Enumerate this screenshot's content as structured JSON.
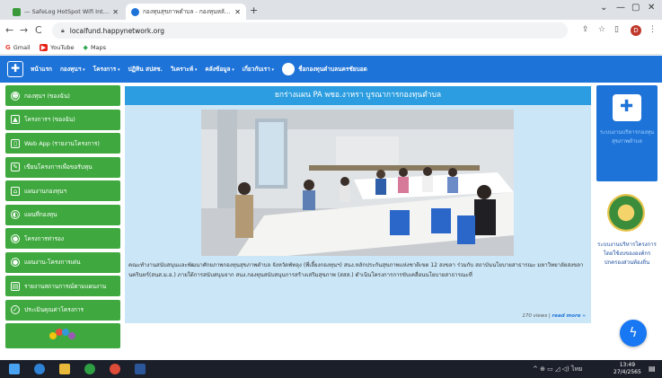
{
  "browser": {
    "tabs": [
      {
        "title": "— SafeLog HotSpot Wifi Internet",
        "active": false
      },
      {
        "title": "กองทุนสุขภาพตำบล - กองทุนหลักประกัน",
        "active": true
      }
    ],
    "new_tab": "+",
    "url": "localfund.happynetwork.org",
    "bookmarks": [
      {
        "label": "Gmail",
        "icon": "G"
      },
      {
        "label": "YouTube",
        "icon": "▶"
      },
      {
        "label": "Maps",
        "icon": "◆"
      }
    ],
    "controls": {
      "minimize": "—",
      "restore": "▢",
      "close": "✕",
      "back": "←",
      "forward": "→",
      "reload": "C",
      "share": "⇪",
      "star": "☆",
      "side_panel": "▯",
      "menu": "⋮"
    },
    "profile_initial": "D"
  },
  "site_nav": {
    "items": [
      {
        "label": "หน้าแรก",
        "caret": false
      },
      {
        "label": "กองทุนฯ",
        "caret": true
      },
      {
        "label": "โครงการ",
        "caret": true
      },
      {
        "label": "ปฏิทิน สปสช.",
        "caret": false
      },
      {
        "label": "วิเคราะห์",
        "caret": true
      },
      {
        "label": "คลังข้อมูล",
        "caret": true
      },
      {
        "label": "เกี่ยวกับเรา",
        "caret": true
      }
    ],
    "user_label": "ชื่อกองทุนตำบลนครชัยบอด"
  },
  "sidebar": {
    "items": [
      {
        "label": "กองทุนฯ (ของฉัน)",
        "icon": "☻"
      },
      {
        "label": "โครงการฯ (ของฉัน)",
        "icon": "▲"
      },
      {
        "label": "Web App (รายงานโครงการ)",
        "icon": "▯"
      },
      {
        "label": "เขียนโครงการเพื่อขอรับทุน",
        "icon": "✎"
      },
      {
        "label": "แผนงานกองทุนฯ",
        "icon": "⌂"
      },
      {
        "label": "แผนที่กองทุน",
        "icon": "◐"
      },
      {
        "label": "โครงการท่ารอง",
        "icon": "●"
      },
      {
        "label": "แผนงาน-โครงการเด่น",
        "icon": "●"
      },
      {
        "label": "รายงานสถานการณ์ตามแผนงาน",
        "icon": "▤"
      },
      {
        "label": "ประเมินคุณค่าโครงการ",
        "icon": "✓"
      }
    ]
  },
  "main": {
    "banner_title": "ยกร่างแผน PA พชอ.งาหรา บูรณาการกองทุนตำบล",
    "caption": "คณะทำงานสนับสนุนและพัฒนาศักยภาพกองทุนสุขภาพตำบล จังหวัดพัทลุง (พี่เลี้ยงกองทุนฯ) สนง.หลักประกันสุขภาพแห่งชาติเขต 12 สงขลา ร่วมกับ สถาบันนโยบายสาธารณะ มหาวิทยาลัยสงขลานครินทร์(สนส.ม.อ.) ภายใต้การสนับสนุนจาก สนง.กองทุนสนับสนุนการสร้างเสริมสุขภาพ (สสส.) ดำเนินโครงการการขับเคลื่อนนโยบายสาธารณะที่",
    "views": "170 views |",
    "read_more": "read more »"
  },
  "right": {
    "box1_text": "ระบบงานบริหารกองทุนสุขภาพตำบล",
    "box2_text": "ระบบงานบริหารโครงการโดยใช้งบขององค์กรปกครองส่วนท้องถิ่น"
  },
  "messenger_icon": "messenger-icon",
  "taskbar": {
    "tray": "^  ⊕  ▭  ◿  ◁)  ไทย",
    "time": "13:49",
    "date": "27/4/2565",
    "notif": "▤"
  },
  "colors": {
    "nav_blue": "#1e73d8",
    "sidebar_green": "#3fa93f",
    "banner_blue": "#2b9de0",
    "main_bg": "#cbe6f6"
  }
}
